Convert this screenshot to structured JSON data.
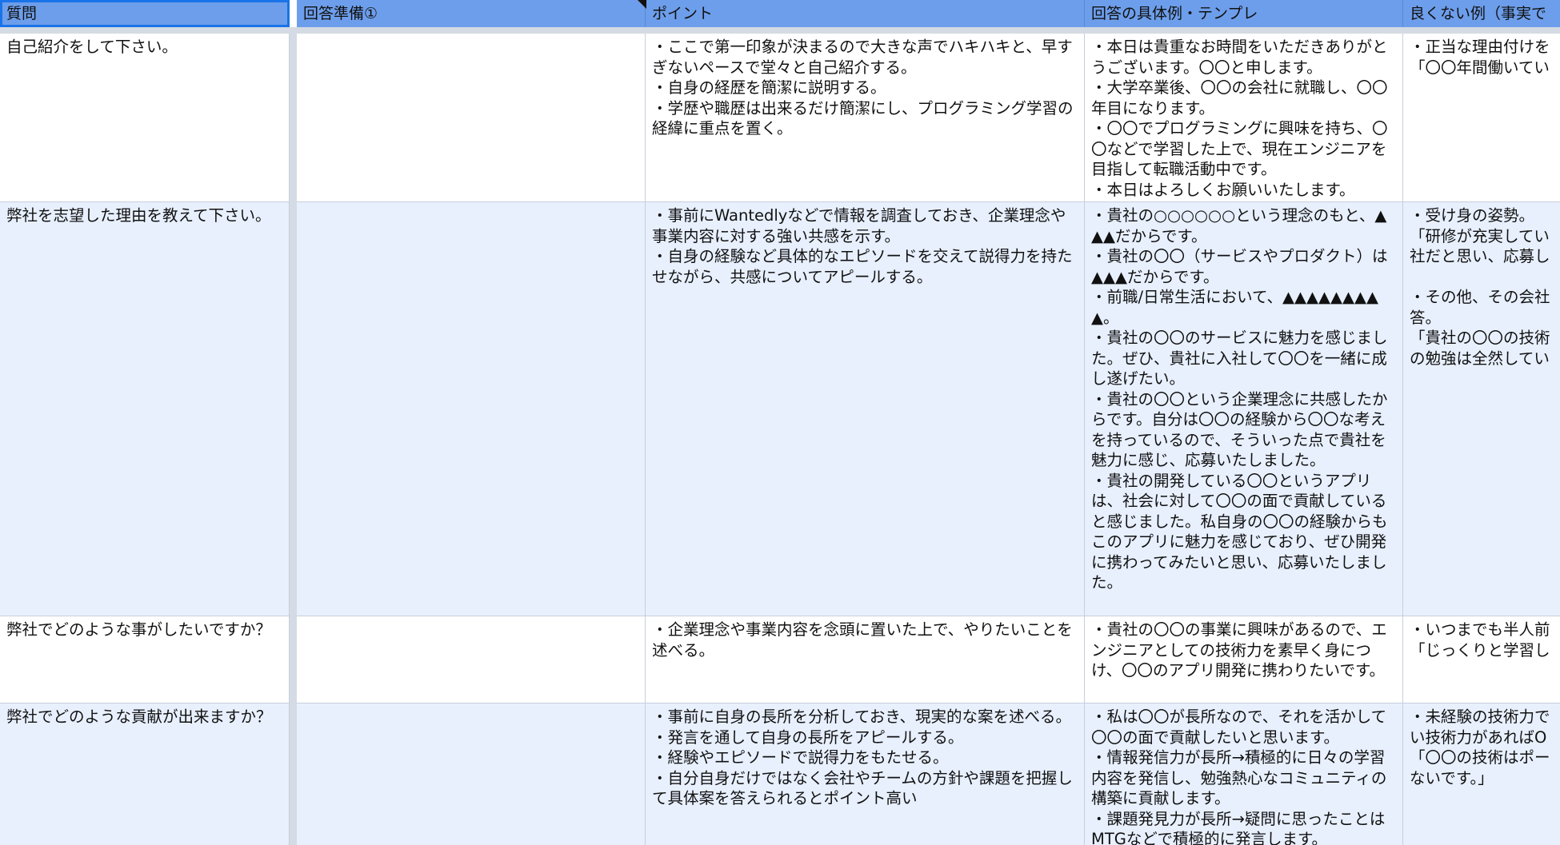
{
  "headers": {
    "question": "質問",
    "prep1": "回答準備①",
    "point": "ポイント",
    "example": "回答の具体例・テンプレ",
    "bad": "良くない例（事実で"
  },
  "rows": [
    {
      "question": "自己紹介をして下さい。",
      "prep1": "",
      "point": "・ここで第一印象が決まるので大きな声でハキハキと、早すぎないペースで堂々と自己紹介する。\n・自身の経歴を簡潔に説明する。\n・学歴や職歴は出来るだけ簡潔にし、プログラミング学習の経緯に重点を置く。",
      "example": "・本日は貴重なお時間をいただきありがとうございます。〇〇と申します。\n・大学卒業後、〇〇の会社に就職し、〇〇年目になります。\n・〇〇でプログラミングに興味を持ち、〇〇などで学習した上で、現在エンジニアを目指して転職活動中です。\n・本日はよろしくお願いいたします。",
      "bad": "・正当な理由付けを\n「〇〇年間働いてい"
    },
    {
      "question": "弊社を志望した理由を教えて下さい。",
      "prep1": "",
      "point": "・事前にWantedlyなどで情報を調査しておき、企業理念や事業内容に対する強い共感を示す。\n・自身の経験など具体的なエピソードを交えて説得力を持たせながら、共感についてアピールする。",
      "example": "・貴社の○○○○○○という理念のもと、▲▲▲だからです。\n・貴社の〇〇（サービスやプロダクト）は▲▲▲だからです。\n・前職/日常生活において、▲▲▲▲▲▲▲▲▲。\n・貴社の〇〇のサービスに魅力を感じました。ぜひ、貴社に入社して〇〇を一緒に成し遂げたい。\n・貴社の〇〇という企業理念に共感したからです。自分は〇〇の経験から〇〇な考えを持っているので、そういった点で貴社を魅力に感じ、応募いたしました。\n・貴社の開発している〇〇というアプリは、社会に対して〇〇の面で貢献していると感じました。私自身の〇〇の経験からもこのアプリに魅力を感じており、ぜひ開発に携わってみたいと思い、応募いたしました。",
      "bad": "・受け身の姿勢。\n「研修が充実してい\n社だと思い、応募し\n\n・その他、その会社\n答。\n「貴社の〇〇の技術\nの勉強は全然してい"
    },
    {
      "question": "弊社でどのような事がしたいですか？",
      "prep1": "",
      "point": "・企業理念や事業内容を念頭に置いた上で、やりたいことを述べる。",
      "example": "・貴社の〇〇の事業に興味があるので、エンジニアとしての技術力を素早く身につけ、〇〇のアプリ開発に携わりたいです。",
      "bad": "・いつまでも半人前\n「じっくりと学習し"
    },
    {
      "question": "弊社でどのような貢献が出来ますか？",
      "prep1": "",
      "point": "・事前に自身の長所を分析しておき、現実的な案を述べる。\n・発言を通して自身の長所をアピールする。\n・経験やエピソードで説得力をもたせる。\n・自分自身だけではなく会社やチームの方針や課題を把握して具体案を答えられるとポイント高い",
      "example": "・私は〇〇が長所なので、それを活かして〇〇の面で貢献したいと思います。\n・情報発信力が長所→積極的に日々の学習内容を発信し、勉強熱心なコミュニティの構築に貢献します。\n・課題発見力が長所→疑問に思ったことはMTGなどで積極的に発言します。",
      "bad": "・未経験の技術力で\nい技術力があればO\n「〇〇の技術はポー\nないです。」"
    }
  ]
}
